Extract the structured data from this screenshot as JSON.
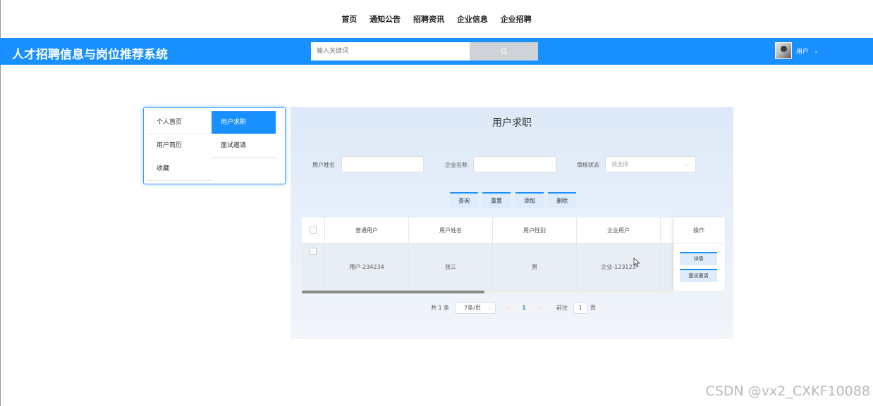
{
  "topnav": {
    "items": [
      "首页",
      "通知公告",
      "招聘资讯",
      "企业信息",
      "企业招聘"
    ]
  },
  "header": {
    "title": "人才招聘信息与岗位推荐系统",
    "search_placeholder": "输入关键词",
    "user_name": "用户",
    "user_caret": "⌄"
  },
  "sidemenu": {
    "items": [
      "个人首页",
      "用户求职",
      "用户简历",
      "面试邀请",
      "收藏"
    ],
    "active": "用户求职"
  },
  "main": {
    "title": "用户求职",
    "filters": {
      "user_name_label": "用户姓名",
      "company_name_label": "企业名称",
      "status_label": "审核状态",
      "status_placeholder": "请选择"
    },
    "buttons": [
      "查询",
      "重置",
      "添加",
      "删除"
    ],
    "table": {
      "columns": [
        "普通用户",
        "用户姓名",
        "用户性别",
        "企业用户",
        "操作"
      ],
      "rows": [
        {
          "user": "用户-234234",
          "name": "张三",
          "gender": "男",
          "company": "企业-123123"
        }
      ],
      "row_actions": [
        "详情",
        "面试邀请"
      ]
    },
    "pagination": {
      "total": "共 1 条",
      "page_size": "7条/页",
      "current_page": "1",
      "goto_label": "前往",
      "goto_value": "1",
      "page_suffix": "页"
    }
  },
  "watermark": "CSDN @vx2_CXKF10088",
  "colors": {
    "primary": "#1890ff",
    "panel_bg": "#e2ecf8"
  }
}
